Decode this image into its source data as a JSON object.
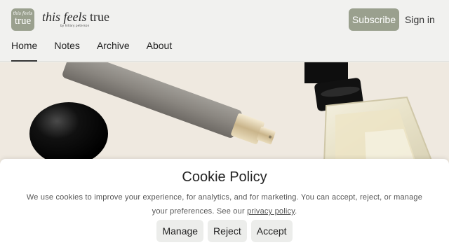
{
  "header": {
    "logo_small": "this feels",
    "logo_big": "true",
    "brand_italic": "this feels",
    "brand_regular": "true",
    "byline": "by hillary peterson",
    "subscribe_label": "Subscribe",
    "signin_label": "Sign in"
  },
  "nav": {
    "items": [
      {
        "label": "Home",
        "active": true
      },
      {
        "label": "Notes",
        "active": false
      },
      {
        "label": "Archive",
        "active": false
      },
      {
        "label": "About",
        "active": false
      }
    ]
  },
  "cookie": {
    "title": "Cookie Policy",
    "text_before": "We use cookies to improve your experience, for analytics, and for marketing. You can accept, reject, or manage your preferences. See our",
    "link": "privacy policy",
    "text_after": ".",
    "buttons": {
      "manage": "Manage",
      "reject": "Reject",
      "accept": "Accept"
    }
  },
  "colors": {
    "accent": "#9aa08e",
    "background": "#f1f1ef"
  }
}
